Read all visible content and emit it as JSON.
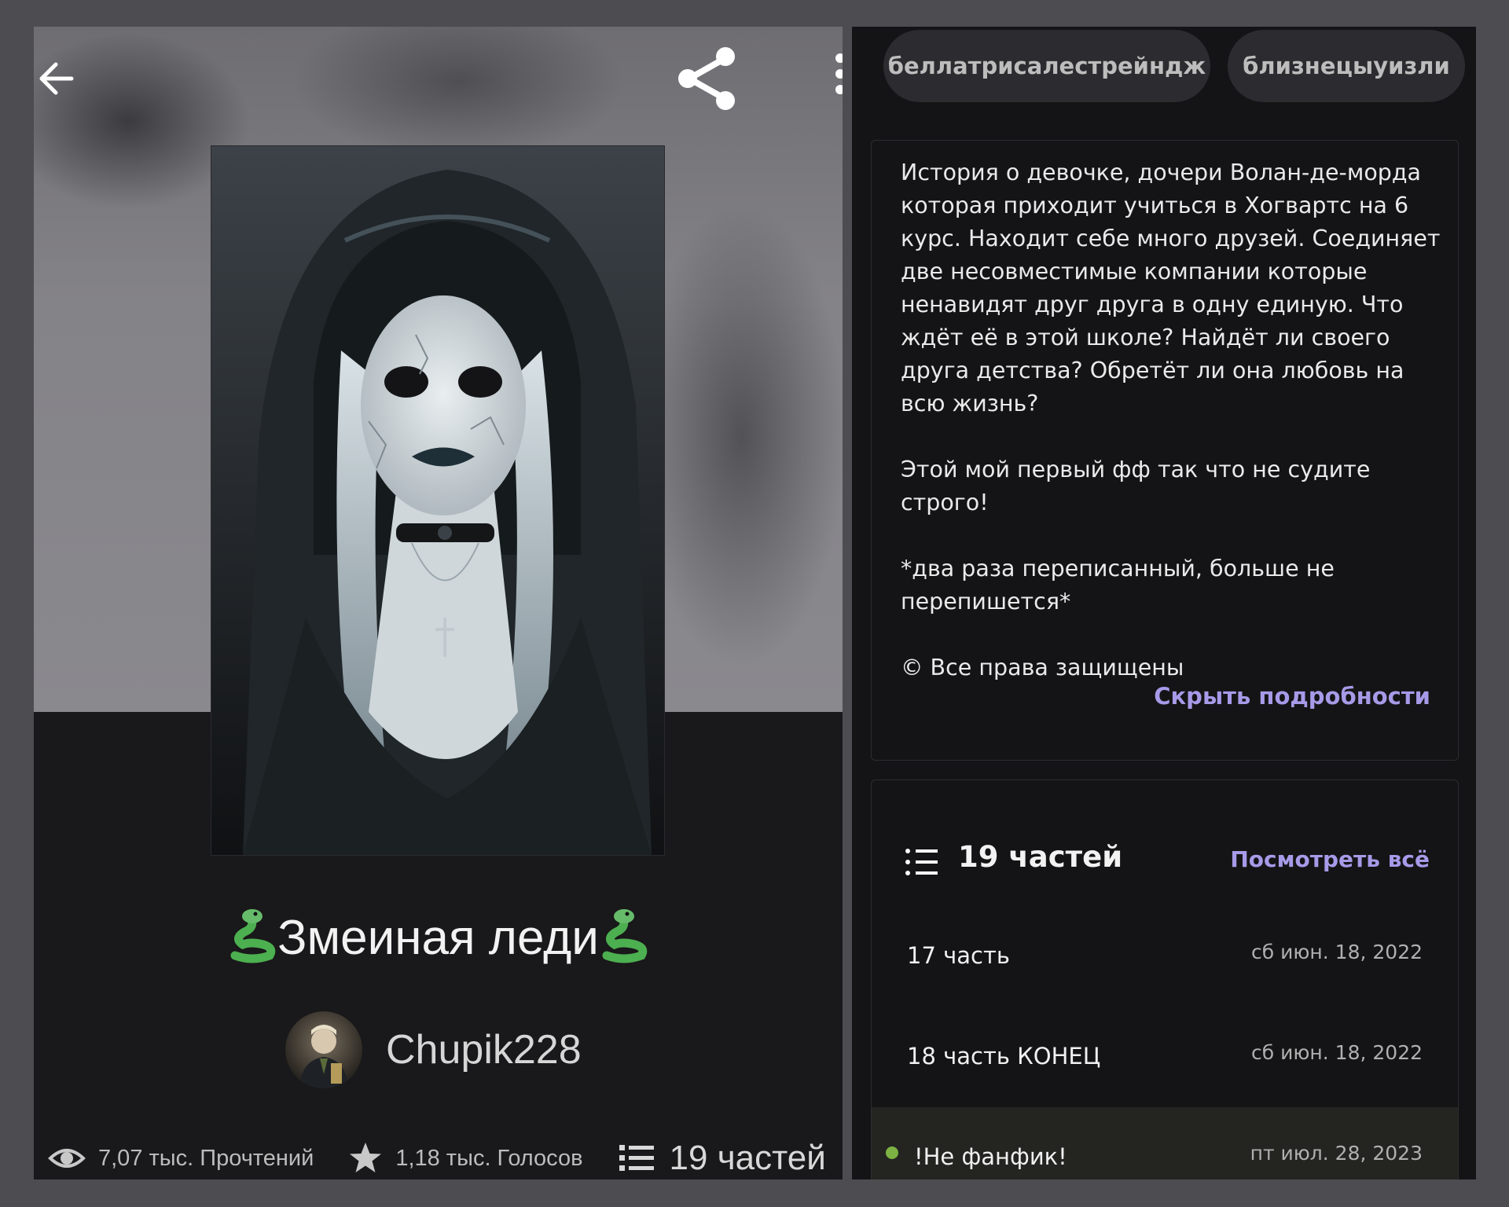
{
  "story": {
    "title": "Змеиная леди",
    "author": "Chupik228",
    "reads": "7,07 тыс. Прочтений",
    "votes": "1,18 тыс. Голосов",
    "parts_stat": "19 частей"
  },
  "tags": [
    "беллатрисалестрейндж",
    "близнецыуизли"
  ],
  "description": {
    "paragraphs": [
      "История о девочке, дочери Волан-де-морда которая приходит учиться в Хогвартс на 6 курс. Находит себе много друзей. Соединяет две несовместимые компании которые ненавидят друг друга в одну единую. Что ждёт её в этой школе? Найдёт ли своего друга детства? Обретёт ли она любовь на всю жизнь?",
      "Этой мой первый фф так что не судите строго!",
      "*два раза переписанный, больше не перепишется*",
      "© Все права защищены"
    ],
    "hide_label": "Скрыть подробности"
  },
  "parts": {
    "count_label": "19 частей",
    "view_all_label": "Посмотреть всё",
    "items": [
      {
        "title": "17 часть",
        "date": "сб июн. 18, 2022"
      },
      {
        "title": "18 часть КОНЕЦ",
        "date": "сб июн. 18, 2022"
      },
      {
        "title": "!Не фанфик!",
        "date": "пт июл. 28, 2023"
      }
    ]
  },
  "icons": {
    "back": "arrow-left-icon",
    "share": "share-icon",
    "more": "more-vertical-icon",
    "snake": "snake-emoji",
    "reads": "eye-icon",
    "votes": "star-icon",
    "parts": "list-icon"
  },
  "colors": {
    "accent": "#a79ae8",
    "new_dot": "#7cb342",
    "panel_bg": "#19181a"
  }
}
